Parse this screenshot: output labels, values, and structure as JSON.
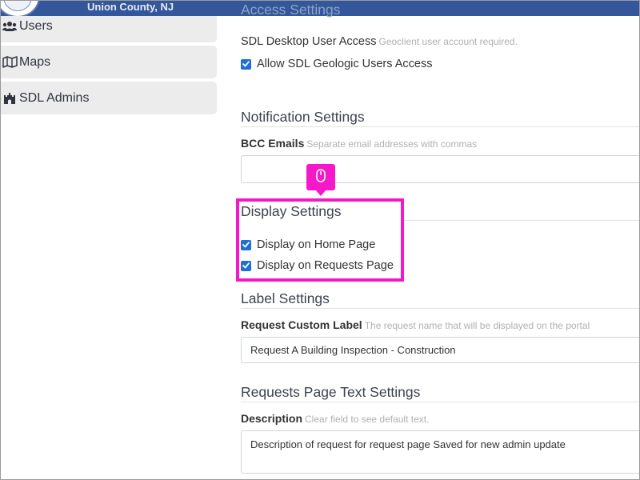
{
  "header": {
    "county": "Union County, NJ",
    "bg_color": "#33579a"
  },
  "sidebar": {
    "items": [
      {
        "label": "Users",
        "icon": "users-icon"
      },
      {
        "label": "Maps",
        "icon": "map-icon"
      },
      {
        "label": "SDL Admins",
        "icon": "castle-icon"
      }
    ]
  },
  "access": {
    "title": "Access Settings",
    "desktop_label": "SDL Desktop User Access",
    "desktop_hint": "Geoclient user account required.",
    "allow_label": "Allow SDL Geologic Users Access",
    "allow_checked": true
  },
  "notification": {
    "title": "Notification Settings",
    "bcc_label": "BCC Emails",
    "bcc_hint": "Separate email addresses with commas",
    "bcc_value": ""
  },
  "display": {
    "title": "Display Settings",
    "home_label": "Display on Home Page",
    "home_checked": true,
    "requests_label": "Display on Requests Page",
    "requests_checked": true
  },
  "label_settings": {
    "title": "Label Settings",
    "custom_label": "Request Custom Label",
    "custom_hint": "The request name that will be displayed on the portal",
    "custom_value": "Request  A Building Inspection - Construction"
  },
  "requests_text": {
    "title": "Requests Page Text Settings",
    "desc_label": "Description",
    "desc_hint": "Clear field to see default text.",
    "desc_value": "Description of request for request page Saved for new admin update"
  },
  "highlight": {
    "color": "#f418c8",
    "icon": "mouse-icon"
  },
  "colors": {
    "checkbox": "#1f6fd6",
    "sidebar_bg": "#ececec"
  }
}
